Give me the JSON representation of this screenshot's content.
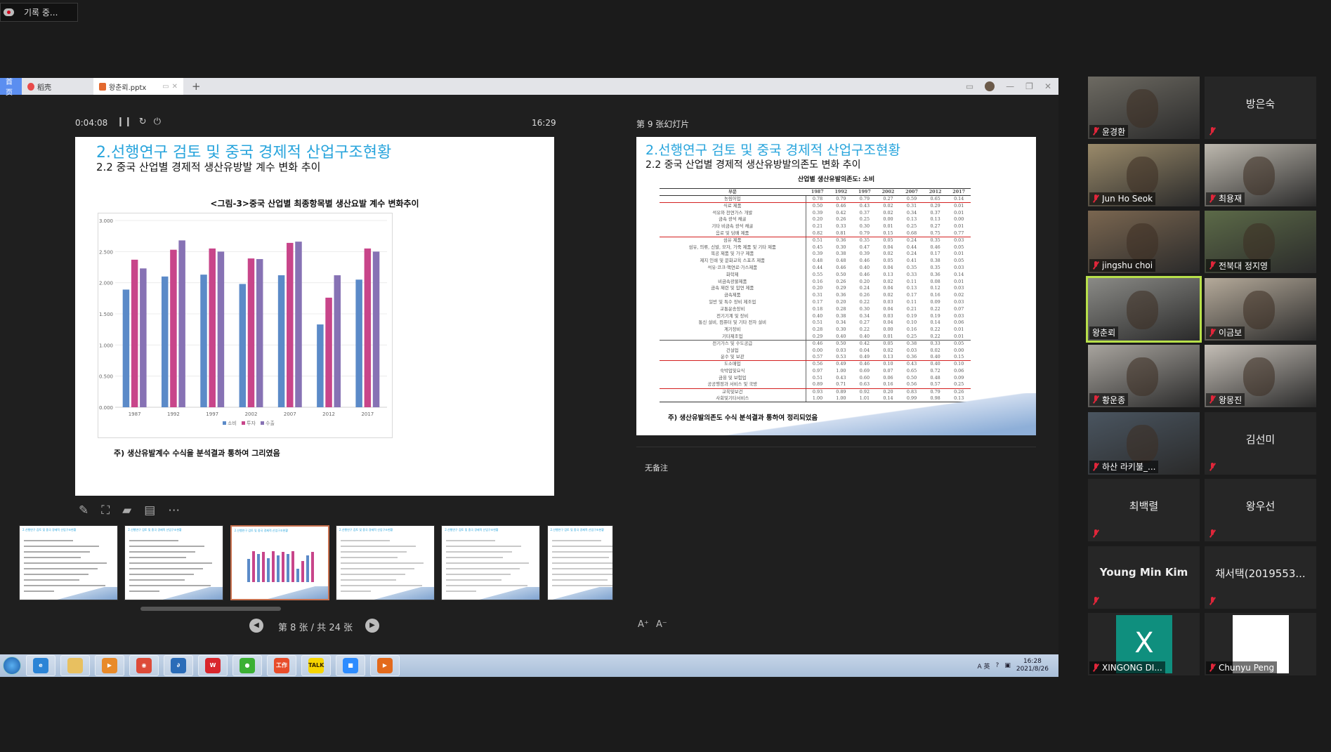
{
  "recording": {
    "label": "기록 중..."
  },
  "tabs": {
    "home": "首页",
    "daoke": "稻壳",
    "file": "왕춘뢰.pptx"
  },
  "presenter": {
    "elapsed": "0:04:08",
    "clock": "16:29",
    "next_label": "第 9 张幻灯片",
    "notes": "无备注",
    "font_increase": "A⁺",
    "font_decrease": "A⁻",
    "pager": "第 8 张 / 共 24 张"
  },
  "tools": [
    "pen-icon",
    "screenshot-icon",
    "camera-icon",
    "comment-icon",
    "more-icon"
  ],
  "current_slide": {
    "title": "2.선행연구 검토 및 중국 경제적 산업구조현황",
    "subtitle": "2.2 중국 산업별  경제적 생산유방발 계수 변화 추이",
    "note": "주) 생산유발계수 수식을  분석결과 통하여 그리였음",
    "accent": "#27a4dc"
  },
  "chart_data": {
    "type": "bar",
    "title": "<그림-3>중국 산업별 최종항목별 생산요발 계수 변화추이",
    "categories": [
      "1987",
      "1992",
      "1997",
      "2002",
      "2007",
      "2012",
      "2017"
    ],
    "series": [
      {
        "name": "소비",
        "color": "#5b8ac8",
        "values": [
          1.89,
          2.1,
          2.13,
          1.98,
          2.12,
          1.33,
          2.05
        ]
      },
      {
        "name": "투자",
        "color": "#c8458a",
        "values": [
          2.37,
          2.53,
          2.55,
          2.39,
          2.64,
          1.76,
          2.55
        ]
      },
      {
        "name": "수출",
        "color": "#8772b4",
        "values": [
          2.23,
          2.68,
          2.5,
          2.38,
          2.66,
          2.12,
          2.5
        ]
      }
    ],
    "yticks": [
      "0.000",
      "0.500",
      "1.000",
      "1.500",
      "2.000",
      "2.500",
      "3.000"
    ],
    "ylim": [
      0,
      3
    ],
    "grid": true,
    "legend": "bottom"
  },
  "next_slide": {
    "title": "2.선행연구 검토 및 중국 경제적 산업구조현황",
    "subtitle": "2.2 중국 산업별  경제적 생산유방발의존도 변화 추이",
    "table_title": "산업별 생산유발의존도: 소비",
    "note": "주)  생산유발의존도 수식  분석결과 통하여 정리되었음",
    "headers": [
      "부문",
      "1987",
      "1992",
      "1997",
      "2002",
      "2007",
      "2012",
      "2017"
    ],
    "rows": [
      {
        "name": "농림어업",
        "v": [
          "0.78",
          "0.79",
          "0.79",
          "0.27",
          "0.59",
          "0.65",
          "0.14"
        ],
        "highlight": true
      },
      {
        "name": "식료 제품",
        "v": [
          "0.50",
          "0.46",
          "0.43",
          "0.02",
          "0.31",
          "0.29",
          "0.01"
        ]
      },
      {
        "name": "석유와 천연가스 개발",
        "v": [
          "0.39",
          "0.42",
          "0.37",
          "0.02",
          "0.34",
          "0.37",
          "0.01"
        ]
      },
      {
        "name": "금속 광석 채굴",
        "v": [
          "0.20",
          "0.26",
          "0.25",
          "0.00",
          "0.13",
          "0.13",
          "0.00"
        ]
      },
      {
        "name": "기타 비금속 광석 채굴",
        "v": [
          "0.21",
          "0.33",
          "0.30",
          "0.01",
          "0.25",
          "0.27",
          "0.01"
        ]
      },
      {
        "name": "음료 및 담배 제품",
        "v": [
          "0.82",
          "0.81",
          "0.79",
          "0.15",
          "0.68",
          "0.75",
          "0.77"
        ],
        "highlight": true
      },
      {
        "name": "섬유 제품",
        "v": [
          "0.51",
          "0.36",
          "0.35",
          "0.05",
          "0.24",
          "0.35",
          "0.03"
        ]
      },
      {
        "name": "섬유, 의류, 신발, 모자, 가죽 제품 및 기타 제품",
        "v": [
          "0.45",
          "0.30",
          "0.47",
          "0.04",
          "0.44",
          "0.46",
          "0.05"
        ]
      },
      {
        "name": "목공 제품 및 가구 제품",
        "v": [
          "0.39",
          "0.38",
          "0.39",
          "0.02",
          "0.24",
          "0.17",
          "0.01"
        ]
      },
      {
        "name": "제지 인쇄 및 문화교육 스포츠 제품",
        "v": [
          "0.48",
          "0.48",
          "0.46",
          "0.05",
          "0.41",
          "0.38",
          "0.05"
        ]
      },
      {
        "name": "석유·코크·핵연료·가스제품",
        "v": [
          "0.44",
          "0.46",
          "0.40",
          "0.04",
          "0.35",
          "0.35",
          "0.03"
        ]
      },
      {
        "name": "화학제",
        "v": [
          "0.55",
          "0.50",
          "0.46",
          "0.13",
          "0.33",
          "0.36",
          "0.14"
        ]
      },
      {
        "name": "비금속광물제품",
        "v": [
          "0.16",
          "0.26",
          "0.20",
          "0.02",
          "0.11",
          "0.08",
          "0.01"
        ]
      },
      {
        "name": "금속 제련 및 압연 제품",
        "v": [
          "0.20",
          "0.29",
          "0.24",
          "0.04",
          "0.13",
          "0.12",
          "0.03"
        ]
      },
      {
        "name": "금속제품",
        "v": [
          "0.31",
          "0.36",
          "0.26",
          "0.02",
          "0.17",
          "0.16",
          "0.02"
        ]
      },
      {
        "name": "일반 및 특수 장비 제조업",
        "v": [
          "0.17",
          "0.20",
          "0.22",
          "0.03",
          "0.11",
          "0.09",
          "0.03"
        ]
      },
      {
        "name": "교통운송장비",
        "v": [
          "0.18",
          "0.28",
          "0.30",
          "0.04",
          "0.21",
          "0.22",
          "0.07"
        ]
      },
      {
        "name": "전기기계 및 장비",
        "v": [
          "0.40",
          "0.38",
          "0.34",
          "0.03",
          "0.19",
          "0.19",
          "0.03"
        ]
      },
      {
        "name": "통신 설비, 컴퓨터 및 기타 전자 설비",
        "v": [
          "0.51",
          "0.34",
          "0.27",
          "0.04",
          "0.10",
          "0.14",
          "0.06"
        ]
      },
      {
        "name": "계기장비",
        "v": [
          "0.28",
          "0.30",
          "0.22",
          "0.00",
          "0.16",
          "0.22",
          "0.01"
        ]
      },
      {
        "name": "기타제조업",
        "v": [
          "0.29",
          "0.40",
          "0.40",
          "0.01",
          "0.25",
          "0.22",
          "0.01"
        ]
      },
      {
        "name": "전기가스 및 수도공급",
        "v": [
          "0.46",
          "0.50",
          "0.42",
          "0.05",
          "0.38",
          "0.33",
          "0.05"
        ],
        "separator": true
      },
      {
        "name": "건설업",
        "v": [
          "0.00",
          "0.03",
          "0.04",
          "0.02",
          "0.03",
          "0.02",
          "0.00"
        ]
      },
      {
        "name": "운수 및 보관",
        "v": [
          "0.57",
          "0.53",
          "0.49",
          "0.13",
          "0.36",
          "0.40",
          "0.15"
        ],
        "highlight": true
      },
      {
        "name": "도소매업",
        "v": [
          "0.56",
          "0.49",
          "0.46",
          "0.10",
          "0.43",
          "0.40",
          "0.10"
        ]
      },
      {
        "name": "숙박업및요식",
        "v": [
          "0.97",
          "1.00",
          "0.69",
          "0.07",
          "0.65",
          "0.72",
          "0.06"
        ]
      },
      {
        "name": "금융 및 보험업",
        "v": [
          "0.51",
          "0.43",
          "0.60",
          "0.06",
          "0.50",
          "0.48",
          "0.09"
        ]
      },
      {
        "name": "공공행정과 서비스 및 국방",
        "v": [
          "0.89",
          "0.71",
          "0.63",
          "0.16",
          "0.56",
          "0.57",
          "0.25"
        ],
        "highlight": true
      },
      {
        "name": "교육및보건",
        "v": [
          "0.93",
          "0.89",
          "0.92",
          "0.20",
          "0.83",
          "0.79",
          "0.26"
        ]
      },
      {
        "name": "사회및기타서비스",
        "v": [
          "1.00",
          "1.00",
          "1.01",
          "0.14",
          "0.99",
          "0.98",
          "0.13"
        ]
      }
    ]
  },
  "thumbnails": [
    {
      "title": "2.선행연구 검토 및 중국 경제적 산업구조현황",
      "selected": false
    },
    {
      "title": "2.선행연구 검토 및 중국 경제적 산업구조현황",
      "selected": false
    },
    {
      "title": "2.선행연구 검토 및 중국 경제적 산업구조현황",
      "selected": true
    },
    {
      "title": "2.선행연구 검토 및 중국 경제적 산업구조현황",
      "selected": false
    },
    {
      "title": "2.선행연구 검토 및 중국 경제적 산업구조현황",
      "selected": false
    },
    {
      "title": "2.선행연구 검토 및 중국 경제적 산업구조현황",
      "selected": false
    }
  ],
  "participants": [
    {
      "name": "윤경환",
      "video": true,
      "muted": true,
      "bg": "#6d6a62"
    },
    {
      "name": "방은숙",
      "video": false,
      "muted": true
    },
    {
      "name": "Jun Ho Seok",
      "video": true,
      "muted": true,
      "bg": "#9a8a6a"
    },
    {
      "name": "최용재",
      "video": true,
      "muted": true,
      "bg": "#bdb8ae"
    },
    {
      "name": "jingshu choi",
      "video": true,
      "muted": true,
      "bg": "#7a6650"
    },
    {
      "name": "전북대 정지영",
      "video": true,
      "muted": true,
      "bg": "#5c6a48"
    },
    {
      "name": "왕춘뢰",
      "video": true,
      "muted": false,
      "active": true,
      "bg": "#8a8a86"
    },
    {
      "name": "이금보",
      "video": true,
      "muted": true,
      "bg": "#b5aa9a"
    },
    {
      "name": "황운종",
      "video": true,
      "muted": true,
      "bg": "#a8a49e"
    },
    {
      "name": "왕몽진",
      "video": true,
      "muted": true,
      "bg": "#c4beb6"
    },
    {
      "name": "하산 라키불_...",
      "video": true,
      "muted": true,
      "bg": "#4a5560"
    },
    {
      "name": "김선미",
      "video": false,
      "muted": true
    },
    {
      "name": "최백렬",
      "video": false,
      "muted": true
    },
    {
      "name": "왕우선",
      "video": false,
      "muted": true
    },
    {
      "name": "Young Min Kim",
      "video": false,
      "muted": true,
      "bold": true
    },
    {
      "name": "채서택(2019553...",
      "video": false,
      "muted": true
    },
    {
      "name": "XINGONG DI...",
      "video": false,
      "muted": true,
      "avatar": "X",
      "avatar_color": "#0f8f7e"
    },
    {
      "name": "Chunyu Peng",
      "video": false,
      "muted": true,
      "avatar": "",
      "avatar_color": "#ffffff"
    }
  ],
  "taskbar": {
    "apps": [
      {
        "name": "ie",
        "color": "#2b84d6",
        "label": "e"
      },
      {
        "name": "explorer",
        "color": "#e8c060",
        "label": ""
      },
      {
        "name": "media-player",
        "color": "#e88a2a",
        "label": "▶"
      },
      {
        "name": "chrome",
        "color": "#dd4b39",
        "label": "◉"
      },
      {
        "name": "app-blue",
        "color": "#2a6cb8",
        "label": "∂"
      },
      {
        "name": "wps",
        "color": "#d9262c",
        "label": "W"
      },
      {
        "name": "wechat",
        "color": "#3cb034",
        "label": "●"
      },
      {
        "name": "app-red",
        "color": "#e84c2a",
        "label": "工作"
      },
      {
        "name": "kakaotalk",
        "color": "#f6d500",
        "label": "TALK"
      },
      {
        "name": "zoom",
        "color": "#2d8cff",
        "label": "■"
      },
      {
        "name": "presentation",
        "color": "#e36a1c",
        "label": "▶"
      }
    ],
    "time": "16:28",
    "date": "2021/8/26",
    "ime": "A 英"
  }
}
